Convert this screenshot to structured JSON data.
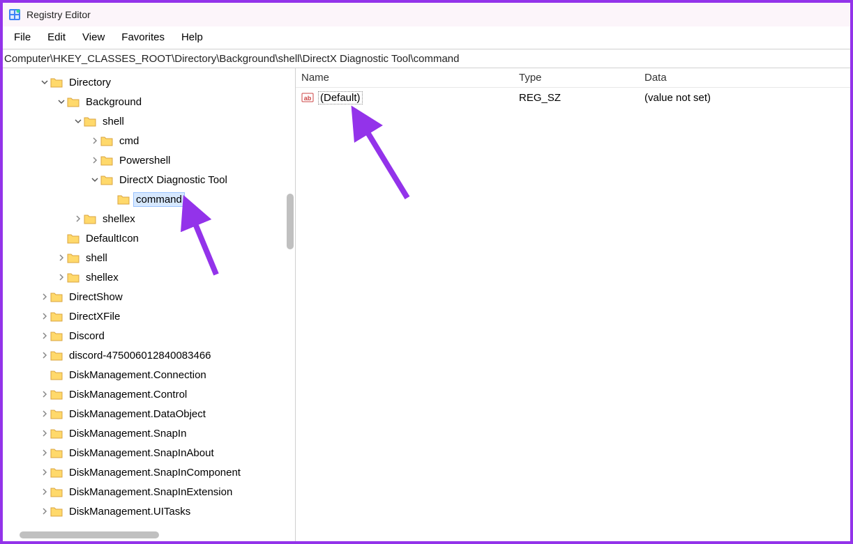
{
  "window": {
    "title": "Registry Editor"
  },
  "menu": {
    "file": "File",
    "edit": "Edit",
    "view": "View",
    "favorites": "Favorites",
    "help": "Help"
  },
  "address": "Computer\\HKEY_CLASSES_ROOT\\Directory\\Background\\shell\\DirectX Diagnostic Tool\\command",
  "tree": {
    "n0": "Directory",
    "n1": "Background",
    "n2": "shell",
    "n3": "cmd",
    "n4": "Powershell",
    "n5": "DirectX Diagnostic Tool",
    "n6": "command",
    "n7": "shellex",
    "n8": "DefaultIcon",
    "n9": "shell",
    "n10": "shellex",
    "n11": "DirectShow",
    "n12": "DirectXFile",
    "n13": "Discord",
    "n14": "discord-475006012840083466",
    "n15": "DiskManagement.Connection",
    "n16": "DiskManagement.Control",
    "n17": "DiskManagement.DataObject",
    "n18": "DiskManagement.SnapIn",
    "n19": "DiskManagement.SnapInAbout",
    "n20": "DiskManagement.SnapInComponent",
    "n21": "DiskManagement.SnapInExtension",
    "n22": "DiskManagement.UITasks"
  },
  "list": {
    "headers": {
      "name": "Name",
      "type": "Type",
      "data": "Data"
    },
    "row0": {
      "name": "(Default)",
      "type": "REG_SZ",
      "data": "(value not set)"
    }
  },
  "colors": {
    "accent": "#9333ea"
  }
}
